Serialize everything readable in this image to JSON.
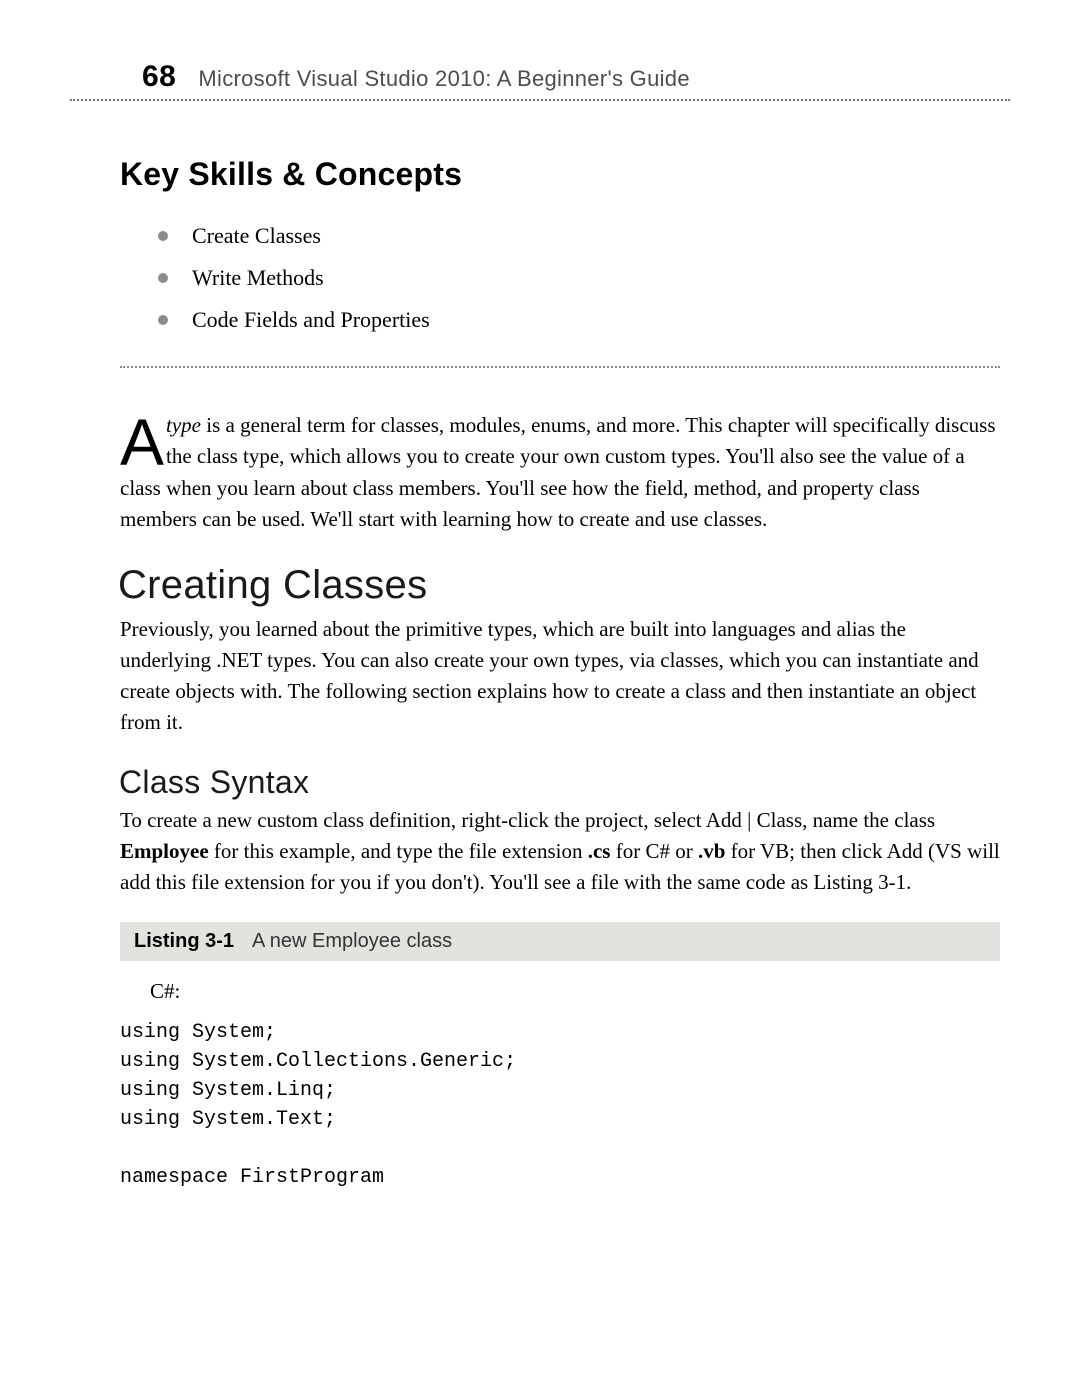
{
  "header": {
    "page_number": "68",
    "running_title": "Microsoft Visual Studio 2010: A Beginner's Guide"
  },
  "key_skills": {
    "title": "Key Skills & Concepts",
    "items": [
      "Create Classes",
      "Write Methods",
      "Code Fields and Properties"
    ]
  },
  "intro": {
    "dropcap": "A",
    "lead_italic": "type",
    "lead_rest_first_sentence": " is a general term for classes, modules, enums, and more. This chapter will specifically discuss the class type, which allows you to create your own custom types.",
    "rest": "You'll also see the value of a class when you learn about class members. You'll see how the field, method, and property class members can be used. We'll start with learning how to create and use classes."
  },
  "creating_classes": {
    "title": "Creating Classes",
    "paragraph": "Previously, you learned about the primitive types, which are built into languages and alias the underlying .NET types. You can also create your own types, via classes, which you can instantiate and create objects with. The following section explains how to create a class and then instantiate an object from it."
  },
  "class_syntax": {
    "title": "Class Syntax",
    "para_parts": {
      "p1": "To create a new custom class definition, right-click the project, select Add | Class, name the class ",
      "bold1": "Employee",
      "p2": " for this example, and type the file extension ",
      "bold2": ".cs",
      "p3": " for C# or ",
      "bold3": ".vb",
      "p4": " for VB; then click Add (VS will add this file extension for you if you don't). You'll see a file with the same code as Listing 3-1."
    }
  },
  "listing": {
    "label": "Listing 3-1",
    "caption": "A new Employee class",
    "lang_label": "C#:",
    "code": "using System;\nusing System.Collections.Generic;\nusing System.Linq;\nusing System.Text;\n\nnamespace FirstProgram"
  }
}
